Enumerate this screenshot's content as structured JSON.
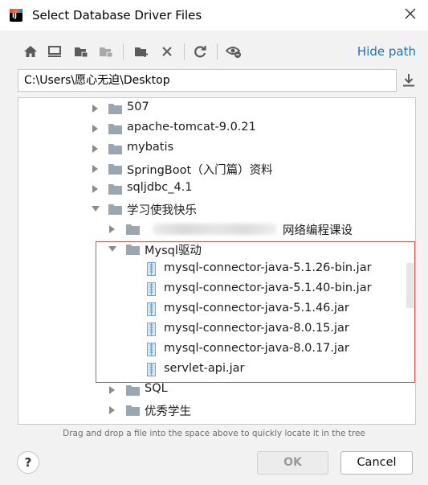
{
  "window": {
    "title": "Select Database Driver Files",
    "app_icon_letters": "IJ"
  },
  "toolbar": {
    "buttons": [
      {
        "name": "home-icon"
      },
      {
        "name": "desktop-icon"
      },
      {
        "name": "project-folder-icon"
      },
      {
        "name": "module-folder-icon"
      },
      {
        "name": "new-folder-icon"
      },
      {
        "name": "delete-icon"
      },
      {
        "name": "refresh-icon"
      },
      {
        "name": "show-hidden-icon"
      }
    ],
    "hide_path_label": "Hide path"
  },
  "path": {
    "value": "C:\\Users\\愿心无迫\\Desktop"
  },
  "tree": {
    "items": [
      {
        "label": "507",
        "level": 0,
        "type": "folder",
        "expanded": false
      },
      {
        "label": "apache-tomcat-9.0.21",
        "level": 0,
        "type": "folder",
        "expanded": false
      },
      {
        "label": "mybatis",
        "level": 0,
        "type": "folder",
        "expanded": false
      },
      {
        "label": "SpringBoot（入门篇）资料",
        "level": 0,
        "type": "folder",
        "expanded": false
      },
      {
        "label": "sqljdbc_4.1",
        "level": 0,
        "type": "folder",
        "expanded": false
      },
      {
        "label": "学习使我快乐",
        "level": 0,
        "type": "folder",
        "expanded": true
      },
      {
        "label": "网络编程课设",
        "level": 1,
        "type": "folder",
        "expanded": false,
        "blurred_prefix": true
      },
      {
        "label": "Mysql驱动",
        "level": 1,
        "type": "folder",
        "expanded": true
      },
      {
        "label": "mysql-connector-java-5.1.26-bin.jar",
        "level": 2,
        "type": "jar"
      },
      {
        "label": "mysql-connector-java-5.1.40-bin.jar",
        "level": 2,
        "type": "jar"
      },
      {
        "label": "mysql-connector-java-5.1.46.jar",
        "level": 2,
        "type": "jar"
      },
      {
        "label": "mysql-connector-java-8.0.15.jar",
        "level": 2,
        "type": "jar"
      },
      {
        "label": "mysql-connector-java-8.0.17.jar",
        "level": 2,
        "type": "jar"
      },
      {
        "label": "servlet-api.jar",
        "level": 2,
        "type": "jar"
      },
      {
        "label": "SQL",
        "level": 1,
        "type": "folder",
        "expanded": false
      },
      {
        "label": "优秀学生",
        "level": 1,
        "type": "folder",
        "expanded": false
      }
    ]
  },
  "hint": "Drag and drop a file into the space above to quickly locate it in the tree",
  "buttons": {
    "help": "?",
    "ok": "OK",
    "cancel": "Cancel"
  },
  "colors": {
    "link": "#2470b3",
    "folder": "#9aa7b0",
    "jar": "#6fa6cf",
    "highlight": "#d9534f"
  }
}
